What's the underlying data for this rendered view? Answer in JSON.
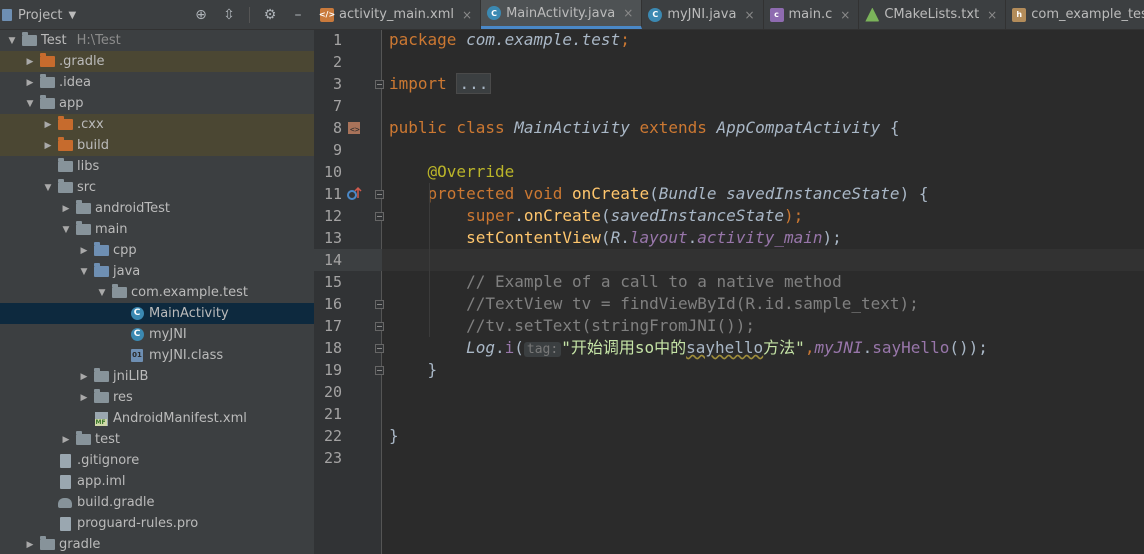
{
  "project_panel": {
    "title": "Project",
    "tools": [
      "target-icon",
      "collapse-icon",
      "gear-icon",
      "hide-icon"
    ],
    "tree": [
      {
        "label": "Test",
        "extra": "H:\\Test",
        "indent": 0,
        "arrow": "down",
        "icon": "module-folder"
      },
      {
        "label": ".gradle",
        "indent": 1,
        "arrow": "right",
        "icon": "folder-orange",
        "excluded": true
      },
      {
        "label": ".idea",
        "indent": 1,
        "arrow": "right",
        "icon": "folder-grey"
      },
      {
        "label": "app",
        "indent": 1,
        "arrow": "down",
        "icon": "module-folder"
      },
      {
        "label": ".cxx",
        "indent": 2,
        "arrow": "right",
        "icon": "folder-orange",
        "excluded": true
      },
      {
        "label": "build",
        "indent": 2,
        "arrow": "right",
        "icon": "folder-orange",
        "excluded": true
      },
      {
        "label": "libs",
        "indent": 2,
        "arrow": "none",
        "icon": "folder-grey"
      },
      {
        "label": "src",
        "indent": 2,
        "arrow": "down",
        "icon": "folder-grey"
      },
      {
        "label": "androidTest",
        "indent": 3,
        "arrow": "right",
        "icon": "folder-grey"
      },
      {
        "label": "main",
        "indent": 3,
        "arrow": "down",
        "icon": "folder-grey"
      },
      {
        "label": "cpp",
        "indent": 4,
        "arrow": "right",
        "icon": "folder-blue"
      },
      {
        "label": "java",
        "indent": 4,
        "arrow": "down",
        "icon": "folder-blue"
      },
      {
        "label": "com.example.test",
        "indent": 5,
        "arrow": "down",
        "icon": "package"
      },
      {
        "label": "MainActivity",
        "indent": 6,
        "arrow": "none",
        "icon": "class",
        "selected": true
      },
      {
        "label": "myJNI",
        "indent": 6,
        "arrow": "none",
        "icon": "class"
      },
      {
        "label": "myJNI.class",
        "indent": 6,
        "arrow": "none",
        "icon": "class-file"
      },
      {
        "label": "jniLIB",
        "indent": 4,
        "arrow": "right",
        "icon": "folder-grey"
      },
      {
        "label": "res",
        "indent": 4,
        "arrow": "right",
        "icon": "folder-grey"
      },
      {
        "label": "AndroidManifest.xml",
        "indent": 4,
        "arrow": "none",
        "icon": "manifest"
      },
      {
        "label": "test",
        "indent": 3,
        "arrow": "right",
        "icon": "folder-grey"
      },
      {
        "label": ".gitignore",
        "indent": 2,
        "arrow": "none",
        "icon": "file"
      },
      {
        "label": "app.iml",
        "indent": 2,
        "arrow": "none",
        "icon": "file"
      },
      {
        "label": "build.gradle",
        "indent": 2,
        "arrow": "none",
        "icon": "gradle"
      },
      {
        "label": "proguard-rules.pro",
        "indent": 2,
        "arrow": "none",
        "icon": "file"
      },
      {
        "label": "gradle",
        "indent": 1,
        "arrow": "right",
        "icon": "folder-grey"
      }
    ]
  },
  "tabs": [
    {
      "label": "activity_main.xml",
      "icon": "xml",
      "badge": "</>"
    },
    {
      "label": "MainActivity.java",
      "icon": "java",
      "badge": "C",
      "active": true
    },
    {
      "label": "myJNI.java",
      "icon": "java",
      "badge": "C"
    },
    {
      "label": "main.c",
      "icon": "c",
      "badge": "c"
    },
    {
      "label": "CMakeLists.txt",
      "icon": "cmake",
      "badge": ""
    },
    {
      "label": "com_example_test_myJNI.h",
      "icon": "h",
      "badge": "h"
    }
  ],
  "editor": {
    "current_line": 14,
    "lines": [
      {
        "n": "1",
        "tokens": [
          [
            "kw",
            "package "
          ],
          [
            "cls-i",
            "com.example.test"
          ],
          [
            "kw",
            ";"
          ]
        ]
      },
      {
        "n": "2",
        "tokens": []
      },
      {
        "n": "3",
        "tokens": [
          [
            "kw",
            "import "
          ],
          [
            "fold-ph",
            "..."
          ]
        ]
      },
      {
        "n": "7",
        "tokens": []
      },
      {
        "n": "8",
        "tokens": [
          [
            "kw",
            "public class "
          ],
          [
            "cls-i",
            "MainActivity "
          ],
          [
            "kw",
            "extends "
          ],
          [
            "cls-i",
            "AppCompatActivity "
          ],
          [
            "plain",
            "{"
          ]
        ]
      },
      {
        "n": "9",
        "tokens": []
      },
      {
        "n": "10",
        "tokens": [
          [
            "plain",
            "    "
          ],
          [
            "ann",
            "@Override"
          ]
        ]
      },
      {
        "n": "11",
        "tokens": [
          [
            "plain",
            "    "
          ],
          [
            "kw",
            "protected void "
          ],
          [
            "fn",
            "onCreate"
          ],
          [
            "plain",
            "("
          ],
          [
            "cls-i",
            "Bundle "
          ],
          [
            "param-i",
            "savedInstanceState"
          ],
          [
            "plain",
            ") {"
          ]
        ]
      },
      {
        "n": "12",
        "tokens": [
          [
            "plain",
            "        "
          ],
          [
            "kw",
            "super"
          ],
          [
            "plain",
            "."
          ],
          [
            "fn",
            "onCreate"
          ],
          [
            "plain",
            "("
          ],
          [
            "param-i",
            "savedInstanceState"
          ],
          [
            "kw",
            ");"
          ]
        ]
      },
      {
        "n": "13",
        "tokens": [
          [
            "plain",
            "        "
          ],
          [
            "fn",
            "setContentView"
          ],
          [
            "plain",
            "("
          ],
          [
            "cls-i",
            "R"
          ],
          [
            "plain",
            "."
          ],
          [
            "purple",
            "layout"
          ],
          [
            "plain",
            "."
          ],
          [
            "purple",
            "activity_main"
          ],
          [
            "plain",
            ");"
          ]
        ]
      },
      {
        "n": "14",
        "tokens": []
      },
      {
        "n": "15",
        "tokens": [
          [
            "plain",
            "        "
          ],
          [
            "cmt",
            "// Example of a call to a native method"
          ]
        ]
      },
      {
        "n": "16",
        "tokens": [
          [
            "plain",
            "        "
          ],
          [
            "cmt",
            "//TextView tv = findViewById(R.id.sample_text);"
          ]
        ]
      },
      {
        "n": "17",
        "tokens": [
          [
            "plain",
            "        "
          ],
          [
            "cmt",
            "//tv.setText(stringFromJNI());"
          ]
        ]
      },
      {
        "n": "18",
        "tokens": [
          [
            "plain",
            "        "
          ],
          [
            "cls-i",
            "Log"
          ],
          [
            "plain",
            "."
          ],
          [
            "purple-n",
            "i"
          ],
          [
            "plain",
            "("
          ],
          [
            "hint",
            "tag:"
          ],
          [
            "str-plain",
            "\"开始调用so中的"
          ],
          [
            "squig",
            "sayhello"
          ],
          [
            "str-plain",
            "方法\""
          ],
          [
            "kw",
            ","
          ],
          [
            "purple",
            "myJNI"
          ],
          [
            "plain",
            "."
          ],
          [
            "purple-n",
            "sayHello"
          ],
          [
            "plain",
            "());"
          ]
        ]
      },
      {
        "n": "19",
        "tokens": [
          [
            "plain",
            "    }"
          ]
        ]
      },
      {
        "n": "20",
        "tokens": []
      },
      {
        "n": "21",
        "tokens": []
      },
      {
        "n": "22",
        "tokens": [
          [
            "plain",
            "}"
          ]
        ]
      },
      {
        "n": "23",
        "tokens": []
      }
    ]
  }
}
